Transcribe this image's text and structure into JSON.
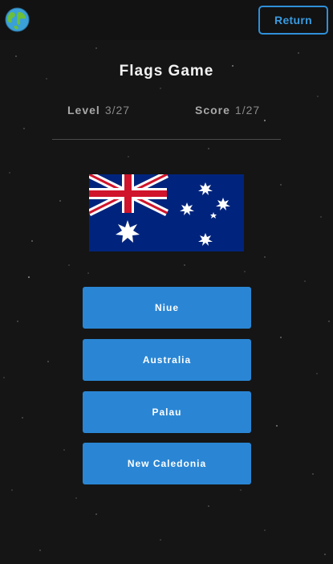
{
  "header": {
    "logo_icon": "globe-icon",
    "return_label": "Return",
    "accent_color": "#2f8fd8"
  },
  "game": {
    "title": "Flags Game",
    "level_label": "Level",
    "level_value": "3/27",
    "score_label": "Score",
    "score_value": "1/27",
    "flag_icon": "australia-flag"
  },
  "answers": [
    {
      "label": "Niue"
    },
    {
      "label": "Australia"
    },
    {
      "label": "Palau"
    },
    {
      "label": "New Caledonia"
    }
  ],
  "colors": {
    "background": "#151515",
    "answer_button": "#2a86d4"
  }
}
